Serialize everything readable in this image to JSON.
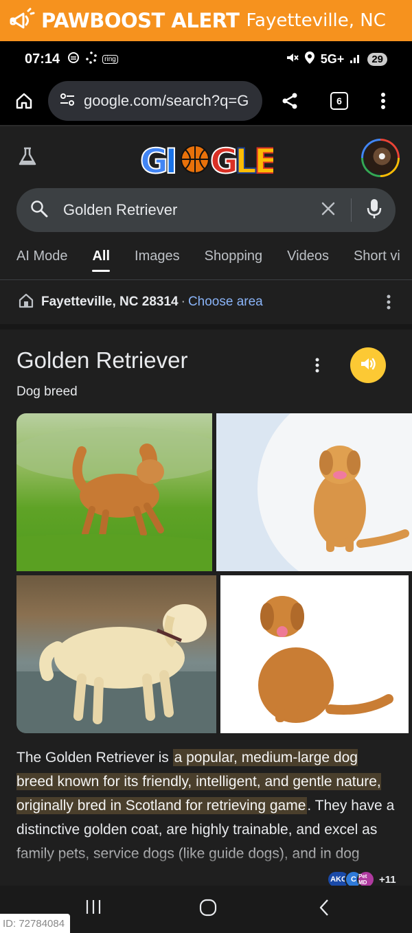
{
  "banner": {
    "brand": "PAWBOOST ALERT",
    "location": "Fayetteville, NC",
    "icon": "megaphone-icon",
    "color": "#f6921e"
  },
  "statusbar": {
    "time": "07:14",
    "ring_label": "ring",
    "network": "5G+",
    "battery": "29"
  },
  "browser": {
    "url": "google.com/search?q=G",
    "tab_count": "6"
  },
  "google": {
    "doodle_text": "GOOGLE",
    "search_query": "Golden Retriever",
    "tabs": [
      "AI Mode",
      "All",
      "Images",
      "Shopping",
      "Videos",
      "Short vi"
    ],
    "active_tab": "All",
    "location": "Fayetteville, NC 28314",
    "location_sep": "·",
    "choose_area": "Choose area"
  },
  "knowledge_panel": {
    "title": "Golden Retriever",
    "subtitle": "Dog breed",
    "images": [
      "golden retriever in grass",
      "golden retriever sitting",
      "golden retriever standing",
      "golden retriever on white"
    ],
    "desc_start": "The Golden Retriever is ",
    "desc_highlight": "a popular, medium-large dog breed known for its friendly, intelligent, and gentle nature, originally bred in Scotland for retrieving game",
    "desc_rest": ". They have a distinctive golden coat, are highly trainable, and excel as family pets, service dogs (like guide dogs), and in dog",
    "sources": [
      "AKC",
      "C",
      "Pet MD"
    ],
    "more_sources": "+11",
    "accent": "#fcc934"
  },
  "footer": {
    "id_label": "ID: 72784084"
  }
}
